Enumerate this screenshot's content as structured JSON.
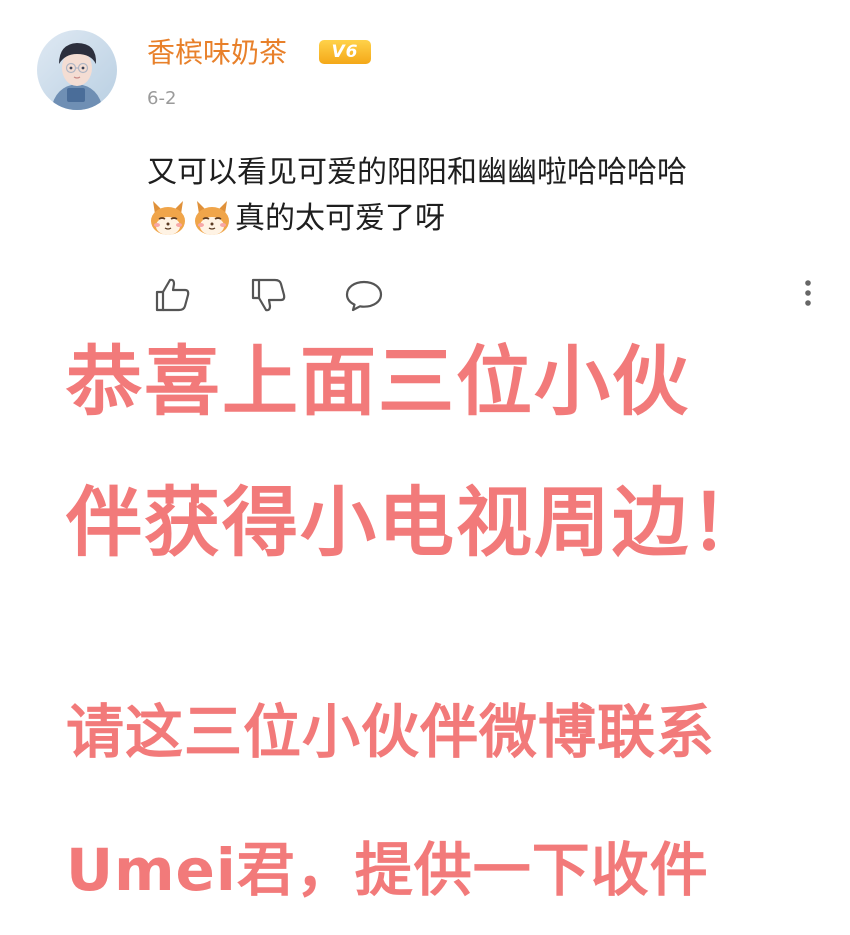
{
  "post": {
    "username": "香槟味奶茶",
    "vip_badge": "V6",
    "date": "6-2",
    "comment_line1": "又可以看见可爱的阳阳和幽幽啦哈哈哈哈",
    "comment_line2_text": "真的太可爱了呀",
    "comment_emojis": [
      "shiba-emoji",
      "shiba-emoji"
    ]
  },
  "actions": {
    "icons": [
      "thumbs-up-icon",
      "thumbs-down-icon",
      "comment-icon",
      "more-icon"
    ]
  },
  "announcement": {
    "line1": "恭喜上面三位小伙",
    "line2": "伴获得小电视周边！",
    "line3": "请这三位小伙伴微博联系",
    "line4": "Umei君，提供一下收件"
  },
  "colors": {
    "username": "#e8802a",
    "vip_badge": "#f4a818",
    "announcement": "#f27a7a",
    "comment_text": "#1e1e1e",
    "date_text": "#9a9a9a"
  }
}
